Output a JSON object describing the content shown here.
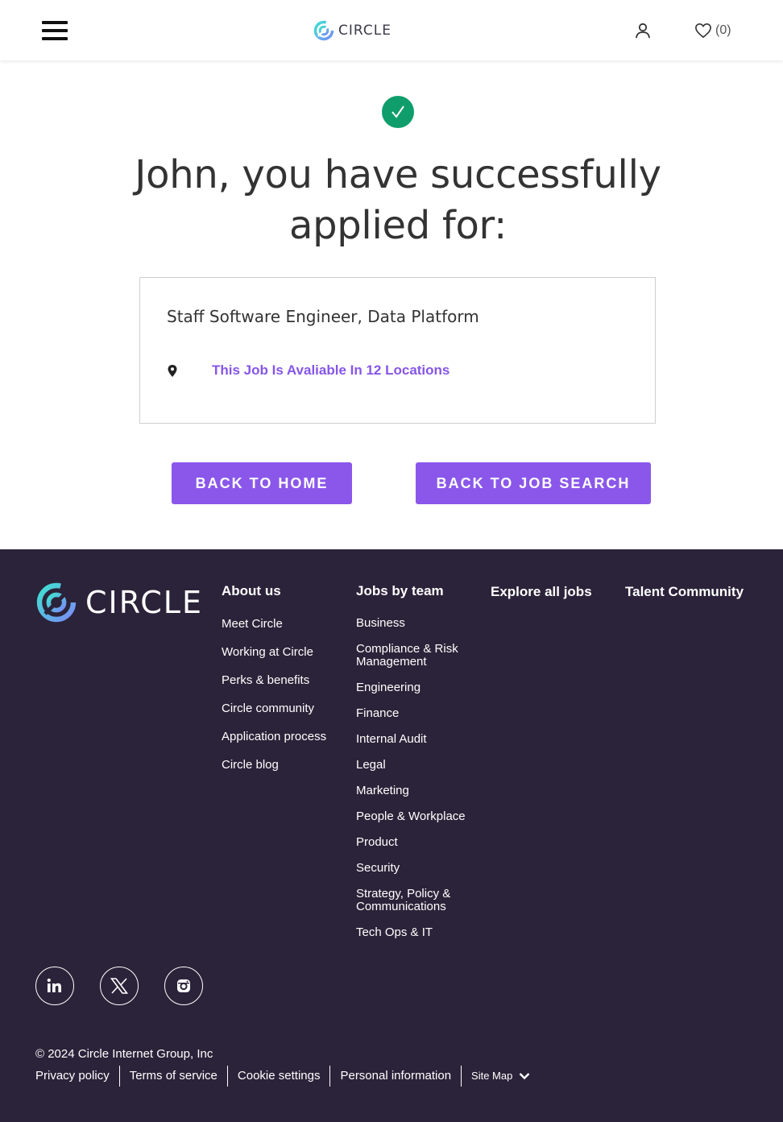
{
  "header": {
    "brand": "CIRCLE",
    "favorites_count": "(0)"
  },
  "main": {
    "headline": "John, you have successfully applied for:",
    "job_title": "Staff Software Engineer, Data Platform",
    "locations_link": "This Job Is Avaliable In 12 Locations",
    "buttons": {
      "home": "BACK TO HOME",
      "job_search": "BACK TO JOB SEARCH"
    }
  },
  "footer": {
    "brand": "CIRCLE",
    "about": {
      "heading": "About us",
      "items": [
        "Meet Circle",
        "Working at Circle",
        "Perks & benefits",
        "Circle community",
        "Application process",
        "Circle blog"
      ]
    },
    "jobs_by_team": {
      "heading": "Jobs by team",
      "items": [
        "Business",
        "Compliance & Risk Management",
        "Engineering",
        "Finance",
        "Internal Audit",
        "Legal",
        "Marketing",
        "People & Workplace",
        "Product",
        "Security",
        "Strategy, Policy & Communications",
        "Tech Ops & IT"
      ]
    },
    "explore_all_jobs": "Explore all jobs",
    "talent_community": "Talent Community",
    "social": [
      "linkedin-icon",
      "x-icon",
      "instagram-icon"
    ],
    "copyright": "© 2024 Circle Internet Group, Inc",
    "legal_links": [
      "Privacy policy",
      "Terms of service",
      "Cookie settings",
      "Personal information"
    ],
    "site_map": "Site Map"
  },
  "colors": {
    "accent_purple": "#8a57ea",
    "link_purple": "#8656e8",
    "success_green": "#0f9d6b",
    "footer_bg": "#2b2339"
  }
}
